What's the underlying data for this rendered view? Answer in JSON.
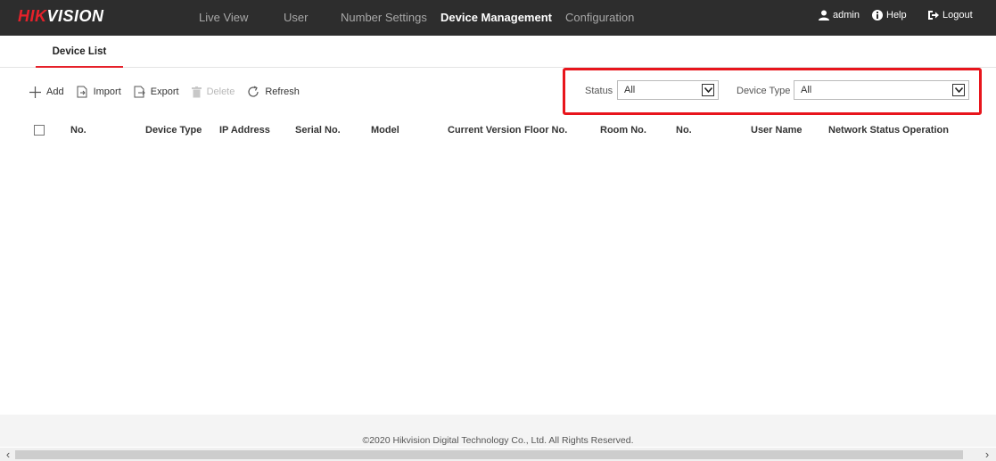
{
  "brand": {
    "part1": "HIK",
    "part2": "VISION",
    "accent": "#e6212a"
  },
  "nav": {
    "items": [
      {
        "label": "Live View"
      },
      {
        "label": "User"
      },
      {
        "label": "Number Settings"
      },
      {
        "label": "Device Management",
        "active": true
      },
      {
        "label": "Configuration"
      }
    ]
  },
  "topright": {
    "user": "admin",
    "help": "Help",
    "logout": "Logout"
  },
  "subtabs": [
    {
      "label": "Device List",
      "active": true
    }
  ],
  "toolbar": {
    "add": "Add",
    "import": "Import",
    "export": "Export",
    "delete": "Delete",
    "refresh": "Refresh"
  },
  "filters": {
    "status": {
      "label": "Status",
      "value": "All"
    },
    "device_type": {
      "label": "Device Type",
      "value": "All"
    }
  },
  "table": {
    "columns": [
      "No.",
      "Device Type",
      "IP Address",
      "Serial No.",
      "Model",
      "Current Version",
      "Floor No.",
      "Room No.",
      "No.",
      "User Name",
      "Network Status",
      "Operation"
    ],
    "rows": []
  },
  "footer": {
    "copyright": "©2020 Hikvision Digital Technology Co., Ltd. All Rights Reserved."
  },
  "colors": {
    "topbar": "#2d2d2d",
    "highlight": "#e8151c",
    "active_tab": "#e6212a"
  }
}
